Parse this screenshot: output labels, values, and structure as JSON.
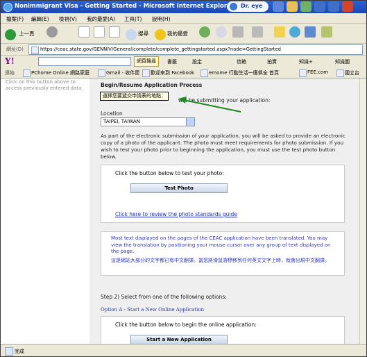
{
  "window": {
    "title": "Nonimmigrant Visa - Getting Started - Microsoft Internet Explorer",
    "dreye_label": "Dr. eye"
  },
  "menu": [
    "檔案(F)",
    "編輯(E)",
    "檢視(V)",
    "我的最愛(A)",
    "工具(T)",
    "說明(H)"
  ],
  "toolbar": {
    "back_label": "上一頁",
    "search_label": "搜尋",
    "favorites_label": "我的最愛"
  },
  "address": {
    "label": "網址(D)",
    "url": "https://ceac.state.gov/GENNIV/General/complete/complete_gettingstarted.aspx?node=GettingStarted"
  },
  "yahoo_bar": {
    "search_button": "網頁搜尋",
    "items": [
      "書籤",
      "設定",
      "信箱",
      "拍賣",
      "知識+",
      "知識圖"
    ]
  },
  "links_bar": {
    "label": "連結",
    "items": [
      "PChome Online 網路家庭",
      "Gmail - 收件匣",
      "歡迎來到 Facebook",
      "emome 行動生活一應俱全 首頁",
      "FEE.com",
      "國立台"
    ]
  },
  "sidebar": {
    "note": "Click on this button above to access previously entered data."
  },
  "main": {
    "heading": "Begin/Resume Application Process",
    "tooltip": "選擇您要遞交申請表的地點：",
    "will_submit": "will be submitting your application:",
    "location_label": "Location",
    "location_value": "TAIPEI, TAIWAN",
    "photo_paragraph": "As part of the electronic submission of your application, you will be asked to provide an electronic copy of a photo of the applicant. The photo must meet requirements for photo submission. If you wish to test your photo prior to beginning the application, you must use the test photo button below.",
    "photo_box_text": "Click the button below to test your photo:",
    "test_photo_button": "Test Photo",
    "photo_standards_link": "Click here to review the photo standards guide",
    "translation_en": "Most text displayed on the pages of the CEAC application have been translated. You may view the translation by positioning your mouse cursor over any group of text displayed on the page.",
    "translation_zh": "這是網站大部分的文字都已有中文翻譯。當您將滑鼠游標移到任何英文文字上時，就會出現中文翻譯。",
    "step2": "Step 2) Select from one of the following options:",
    "option_a": "Option A - Start a New Online Application",
    "option_box_text": "Click the button below to begin the online application:",
    "start_button": "Start a New Application"
  },
  "status": {
    "text": "完成"
  }
}
